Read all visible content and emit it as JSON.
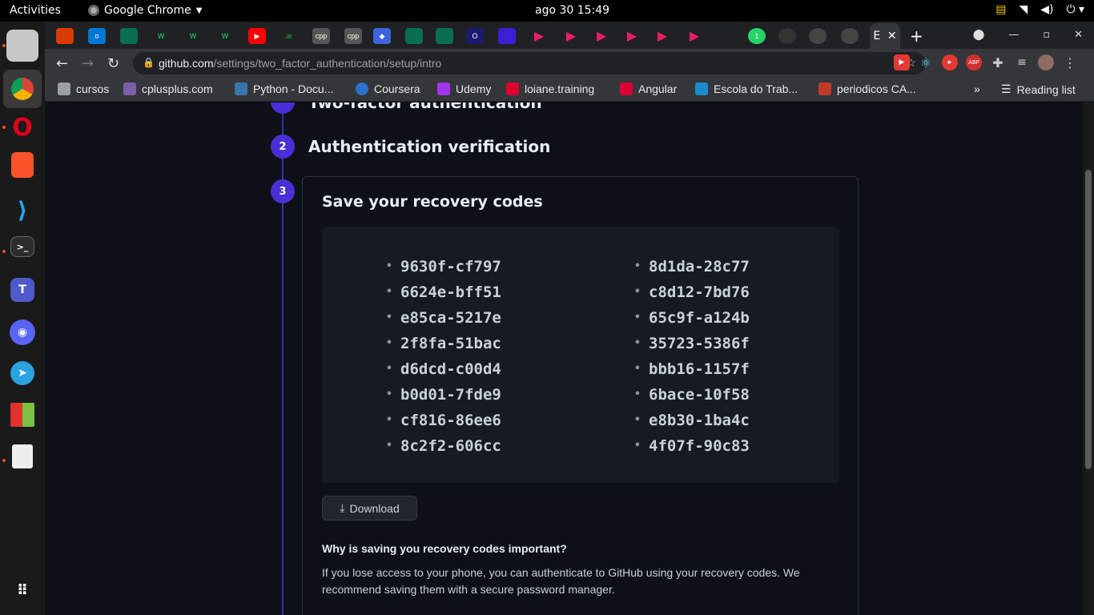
{
  "topbar": {
    "activities": "Activities",
    "app_name": "Google Chrome",
    "clock": "ago 30  15:49"
  },
  "browser": {
    "url_host": "github.com",
    "url_path": "/settings/two_factor_authentication/setup/intro",
    "active_tab_label": "E"
  },
  "bookmarks": [
    {
      "label": "cursos",
      "color": "#9aa0a6"
    },
    {
      "label": "cplusplus.com",
      "color": "#7b5ea7"
    },
    {
      "label": "Python - Docu...",
      "color": "#3776ab"
    },
    {
      "label": "Coursera",
      "color": "#2a73cc"
    },
    {
      "label": "Udemy",
      "color": "#a435f0"
    },
    {
      "label": "loiane.training",
      "color": "#dd0031"
    },
    {
      "label": "Angular",
      "color": "#dd0031"
    },
    {
      "label": "Escola do Trab...",
      "color": "#1a8ccc"
    },
    {
      "label": "periodicos CA...",
      "color": "#c0392b"
    }
  ],
  "reading_list": "Reading list",
  "steps": {
    "step1_title": "Two-factor authentication",
    "step2_num": "2",
    "step2_title": "Authentication verification",
    "step3_num": "3"
  },
  "card": {
    "title": "Save your recovery codes",
    "codes_left": [
      "9630f-cf797",
      "6624e-bff51",
      "e85ca-5217e",
      "2f8fa-51bac",
      "d6dcd-c00d4",
      "b0d01-7fde9",
      "cf816-86ee6",
      "8c2f2-606cc"
    ],
    "codes_right": [
      "8d1da-28c77",
      "c8d12-7bd76",
      "65c9f-a124b",
      "35723-5386f",
      "bbb16-1157f",
      "6bace-10f58",
      "e8b30-1ba4c",
      "4f07f-90c83"
    ],
    "download_label": "Download",
    "why_title": "Why is saving you recovery codes important?",
    "why_text": "If you lose access to your phone, you can authenticate to GitHub using your recovery codes. We recommend saving them with a secure password manager."
  },
  "colors": {
    "accent": "#4a2fd6",
    "page_bg": "#0d1117",
    "codes_bg": "#161b22"
  }
}
